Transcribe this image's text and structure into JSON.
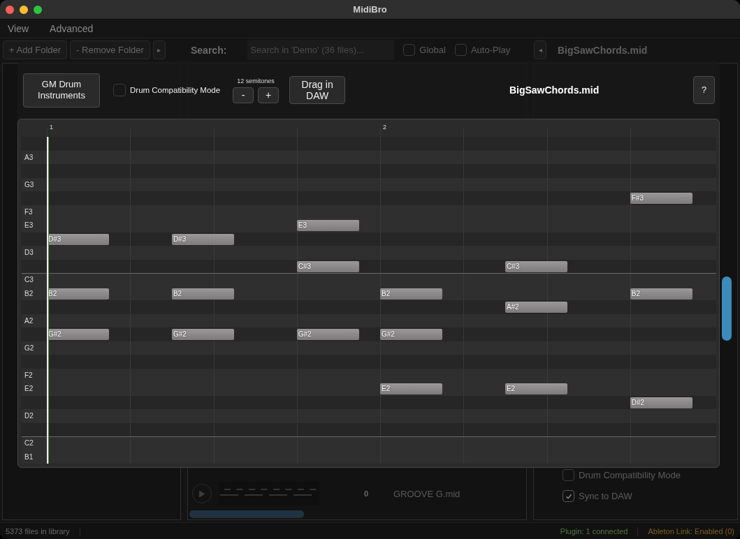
{
  "window": {
    "title": "MidiBro"
  },
  "menu": [
    {
      "label": "View"
    },
    {
      "label": "Advanced"
    }
  ],
  "toolbar": {
    "add_folder": "+ Add Folder",
    "remove_folder": "- Remove Folder",
    "expand_button": "▸",
    "search_label": "Search:",
    "search": {
      "placeholder": "Search in 'Demo' (36 files)..."
    },
    "options": [
      {
        "label": "Global",
        "checked": false
      },
      {
        "label": "Auto-Play",
        "checked": false
      }
    ],
    "collapse_button": "◂",
    "file_title": "BigSawChords.mid"
  },
  "browser": {
    "rows": [
      {
        "name": "GROOVE G.mid",
        "count": "0"
      }
    ]
  },
  "settings": [
    {
      "label": "Drum Compatibility Mode",
      "checked": false
    },
    {
      "label": "Sync to DAW",
      "checked": true
    }
  ],
  "status_bar": {
    "files": "5373 files in library",
    "plugin": "Plugin: 1 connected",
    "link": "Ableton Link: Enabled (0)"
  },
  "dialog": {
    "drum_instruments_button": "GM Drum Instruments",
    "drum_mode": {
      "label": "Drum Compatibility Mode",
      "checked": false
    },
    "transpose": {
      "label": "12 semitones",
      "down": "-",
      "up": "+"
    },
    "drag_button": "Drag in DAW",
    "title": "BigSawChords.mid",
    "help_button": "?",
    "ruler": [
      "1",
      "2"
    ],
    "rows": [
      {
        "kind": "black",
        "divider": false
      },
      {
        "kind": "white",
        "label": "A3",
        "divider": false
      },
      {
        "kind": "black",
        "divider": false
      },
      {
        "kind": "white",
        "label": "G3",
        "divider": false
      },
      {
        "kind": "black",
        "divider": false,
        "cells": [
          {},
          {},
          {},
          {},
          {},
          {},
          {},
          {
            "note": "F#3",
            "offbeat": false
          }
        ]
      },
      {
        "kind": "white",
        "label": "F3",
        "divider": false
      },
      {
        "kind": "white",
        "label": "E3",
        "divider": false,
        "cells": [
          {},
          {},
          {},
          {
            "note": "E3",
            "offbeat": false
          },
          {},
          {},
          {},
          {}
        ]
      },
      {
        "kind": "black",
        "divider": false,
        "cells": [
          {
            "note": "D#3",
            "offbeat": false
          },
          {
            "note": "D#3",
            "offbeat": true
          },
          {},
          {},
          {},
          {},
          {},
          {}
        ]
      },
      {
        "kind": "white",
        "label": "D3",
        "divider": false
      },
      {
        "kind": "black",
        "divider": false,
        "cells": [
          {},
          {},
          {},
          {
            "note": "C#3",
            "offbeat": false
          },
          {},
          {
            "note": "C#3",
            "offbeat": true
          },
          {},
          {}
        ]
      },
      {
        "kind": "white",
        "label": "C3",
        "divider": true
      },
      {
        "kind": "white",
        "label": "B2",
        "divider": false,
        "cells": [
          {
            "note": "B2",
            "offbeat": false
          },
          {
            "note": "B2",
            "offbeat": true
          },
          {},
          {},
          {
            "note": "B2",
            "offbeat": false
          },
          {},
          {},
          {
            "note": "B2",
            "offbeat": false
          }
        ]
      },
      {
        "kind": "black",
        "divider": false,
        "cells": [
          {},
          {},
          {},
          {},
          {},
          {
            "note": "A#2",
            "offbeat": true
          },
          {},
          {}
        ]
      },
      {
        "kind": "white",
        "label": "A2",
        "divider": false
      },
      {
        "kind": "black",
        "divider": false,
        "cells": [
          {
            "note": "G#2",
            "offbeat": false
          },
          {
            "note": "G#2",
            "offbeat": true
          },
          {},
          {
            "note": "G#2",
            "offbeat": false
          },
          {
            "note": "G#2",
            "offbeat": false
          },
          {},
          {},
          {}
        ]
      },
      {
        "kind": "white",
        "label": "G2",
        "divider": false
      },
      {
        "kind": "black",
        "divider": false
      },
      {
        "kind": "white",
        "label": "F2",
        "divider": false
      },
      {
        "kind": "white",
        "label": "E2",
        "divider": false,
        "cells": [
          {},
          {},
          {},
          {},
          {
            "note": "E2",
            "offbeat": false
          },
          {
            "note": "E2",
            "offbeat": true
          },
          {},
          {}
        ]
      },
      {
        "kind": "black",
        "divider": false,
        "cells": [
          {},
          {},
          {},
          {},
          {},
          {},
          {},
          {
            "note": "D#2",
            "offbeat": false
          }
        ]
      },
      {
        "kind": "white",
        "label": "D2",
        "divider": false
      },
      {
        "kind": "black",
        "divider": false
      },
      {
        "kind": "white",
        "label": "C2",
        "divider": true
      },
      {
        "kind": "white",
        "label": "B1",
        "divider": false
      }
    ]
  }
}
